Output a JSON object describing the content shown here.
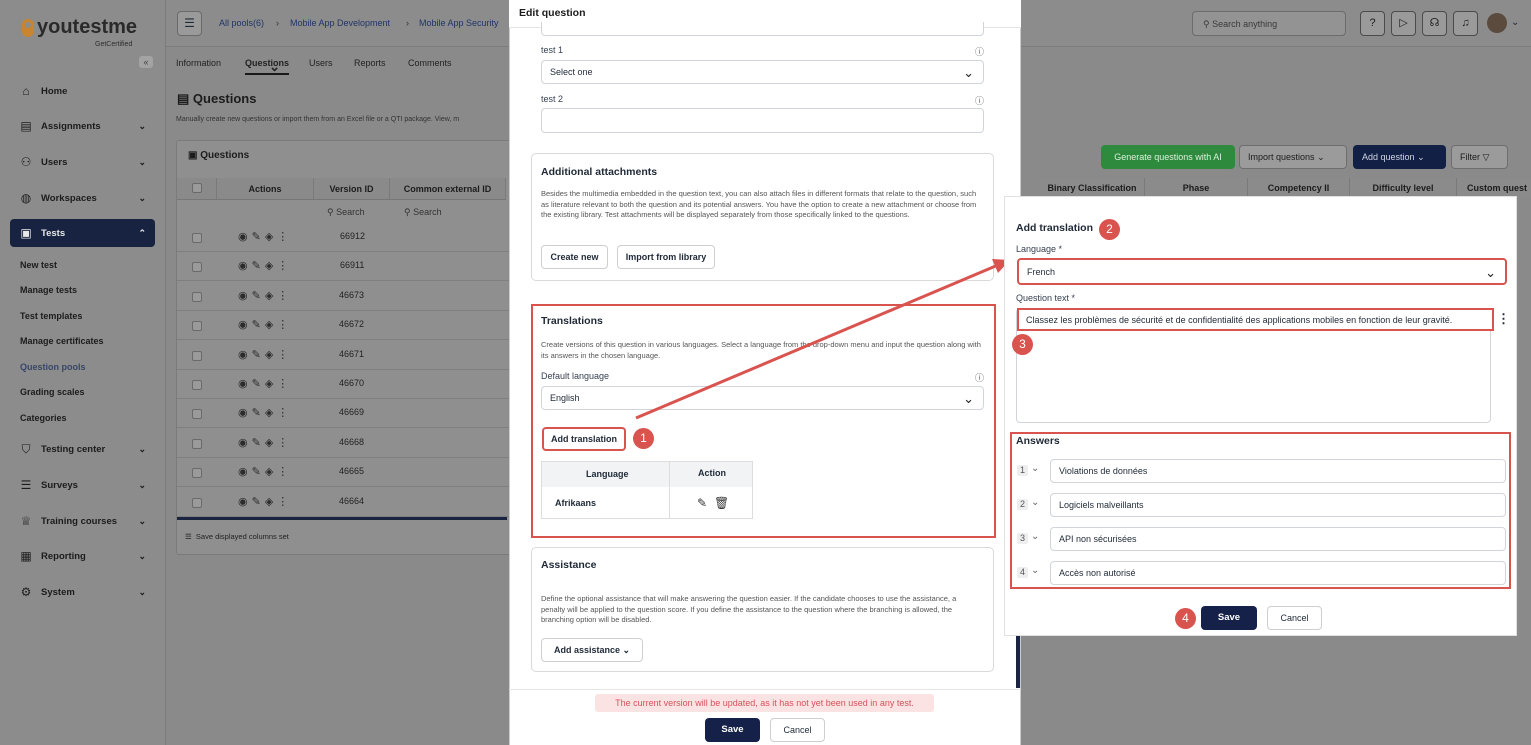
{
  "brand": {
    "logo": "youtestme",
    "sub": "GetCertified"
  },
  "sidebar": {
    "items": [
      {
        "label": "Home",
        "icon": "home-icon"
      },
      {
        "label": "Assignments",
        "icon": "document-icon"
      },
      {
        "label": "Users",
        "icon": "users-icon"
      },
      {
        "label": "Workspaces",
        "icon": "globe-icon"
      },
      {
        "label": "Tests",
        "icon": "test-icon"
      }
    ],
    "sub": [
      "New test",
      "Manage tests",
      "Test templates",
      "Manage certificates",
      "Question pools",
      "Grading scales",
      "Categories"
    ],
    "bottom": [
      {
        "label": "Testing center",
        "icon": "graduation-icon"
      },
      {
        "label": "Surveys",
        "icon": "list-icon"
      },
      {
        "label": "Training courses",
        "icon": "trophy-icon"
      },
      {
        "label": "Reporting",
        "icon": "report-icon"
      },
      {
        "label": "System",
        "icon": "gear-icon"
      }
    ]
  },
  "breadcrumb": [
    "All pools(6)",
    "Mobile App Development",
    "Mobile App Security"
  ],
  "search_placeholder": "Search anything",
  "tabs": [
    "Information",
    "Questions",
    "Users",
    "Reports",
    "Comments"
  ],
  "page": {
    "title": "Questions",
    "desc": "Manually create new questions or import them from an Excel file or a QTI package. View, m",
    "card_title": "Questions",
    "columns": [
      "Actions",
      "Version ID",
      "Common external ID"
    ],
    "search": "Search",
    "ids": [
      "66912",
      "66911",
      "46673",
      "46672",
      "46671",
      "46670",
      "46669",
      "46668",
      "46665",
      "46664"
    ],
    "footer": "Save displayed columns set"
  },
  "right_toolbar": {
    "gen_ai": "Generate questions with AI",
    "import": "Import questions",
    "add": "Add question",
    "filter": "Filter"
  },
  "right_columns": [
    "Binary Classification",
    "Phase",
    "Competency II",
    "Difficulty level",
    "Custom quest"
  ],
  "modal": {
    "title": "Edit question",
    "test1_label": "test 1",
    "test1_value": "Select one",
    "test2_label": "test 2",
    "attach_title": "Additional attachments",
    "attach_text": "Besides the multimedia embedded in the question text, you can also attach files in different formats that relate to the question, such as literature relevant to both the question and its potential answers. You have the option to create a new attachment or choose from the existing library. Test attachments will be displayed separately from those specifically linked to the questions.",
    "create_new": "Create new",
    "import_lib": "Import from library",
    "trans_title": "Translations",
    "trans_text": "Create versions of this question in various languages. Select a language from the drop-down menu and input the question along with its answers in the chosen language.",
    "default_lang_label": "Default language",
    "default_lang_value": "English",
    "add_translation": "Add translation",
    "col_language": "Language",
    "col_action": "Action",
    "row_language": "Afrikaans",
    "assist_title": "Assistance",
    "assist_text": "Define the optional assistance that will make answering the question easier. If the candidate chooses to use the assistance, a penalty will be applied to the question score. If you define the assistance to the question where the branching is allowed, the branching option will be disabled.",
    "add_assistance": "Add assistance",
    "warning": "The current version will be updated, as it has not yet been used in any test.",
    "save": "Save",
    "cancel": "Cancel"
  },
  "translation": {
    "title": "Add translation",
    "language_label": "Language *",
    "language_value": "French",
    "qtext_label": "Question text *",
    "qtext_value": "Classez les problèmes de sécurité et de confidentialité des applications mobiles en fonction de leur gravité.",
    "answers_title": "Answers",
    "answers": [
      "Violations de données",
      "Logiciels malveillants",
      "API non sécurisées",
      "Accès non autorisé"
    ],
    "answer_nums": [
      "1",
      "2",
      "3",
      "4"
    ],
    "save": "Save",
    "cancel": "Cancel"
  },
  "badges": [
    "1",
    "2",
    "3",
    "4"
  ]
}
